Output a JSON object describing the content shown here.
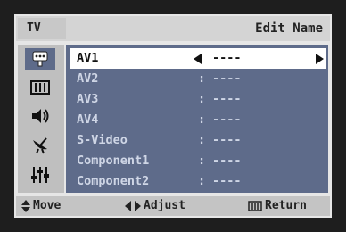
{
  "header": {
    "tv_label": "TV",
    "title": "Edit Name"
  },
  "sidebar": {
    "icons": [
      "input-icon",
      "picture-icon",
      "sound-icon",
      "channel-icon",
      "setup-icon"
    ],
    "active_index": 0
  },
  "list": {
    "items": [
      {
        "name": "AV1",
        "value": "----",
        "selected": true
      },
      {
        "name": "AV2",
        "value": "----"
      },
      {
        "name": "AV3",
        "value": "----"
      },
      {
        "name": "AV4",
        "value": "----"
      },
      {
        "name": "S-Video",
        "value": "----"
      },
      {
        "name": "Component1",
        "value": "----"
      },
      {
        "name": "Component2",
        "value": "----"
      }
    ],
    "separator": ":"
  },
  "footer": {
    "move_label": "Move",
    "adjust_label": "Adjust",
    "return_label": "Return"
  },
  "colors": {
    "panel": "#5e6b8a",
    "selected_row": "#ffffff",
    "osd_background": "#e6e6e6"
  }
}
